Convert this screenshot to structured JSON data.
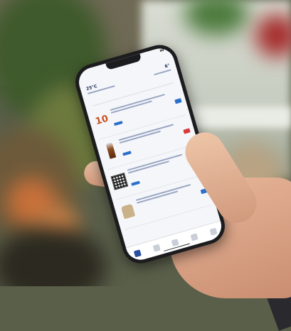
{
  "scene": {
    "description_tag": "phone-in-hand-photo"
  },
  "app": {
    "status_time": "",
    "title": "",
    "weather": {
      "temp_left": "25°C",
      "temp_right": "6°"
    },
    "section_label": "",
    "items": [
      {
        "image": "10",
        "price": "",
        "price_color": "blue"
      },
      {
        "image": "bottle",
        "price": "",
        "price_color": "red"
      },
      {
        "image": "qr",
        "price": "",
        "price_color": "red"
      },
      {
        "image": "sack",
        "price": "",
        "price_color": "blue"
      }
    ]
  }
}
